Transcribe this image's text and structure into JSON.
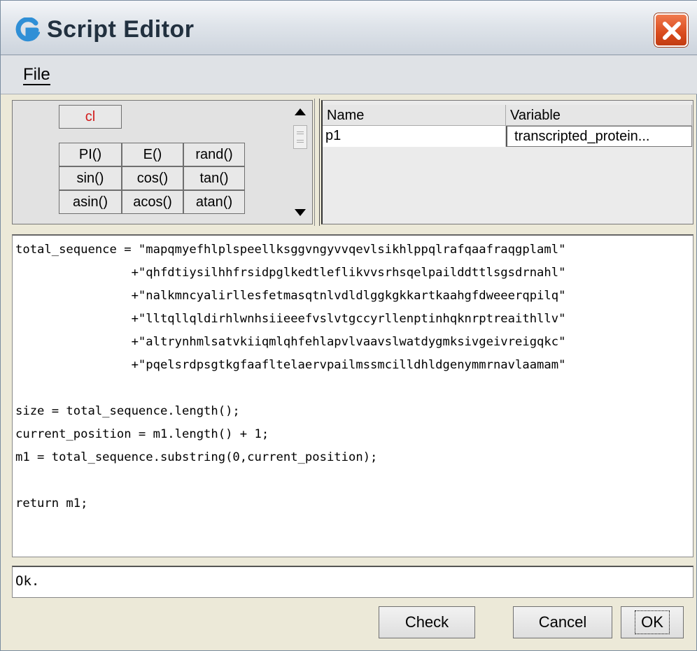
{
  "window": {
    "title": "Script Editor",
    "menu": {
      "file_label": "File"
    }
  },
  "buttons": {
    "clear": "cl",
    "pi": "PI()",
    "e": "E()",
    "rand": "rand()",
    "sin": "sin()",
    "cos": "cos()",
    "tan": "tan()",
    "asin": "asin()",
    "acos": "acos()",
    "atan": "atan()"
  },
  "variables_table": {
    "columns": [
      "Name",
      "Variable"
    ],
    "rows": [
      {
        "name": "p1",
        "variable": "transcripted_protein..."
      }
    ]
  },
  "editor": {
    "lines": [
      "total_sequence = \"mapqmyefhlplspeellksggvngyvvqevlsikhlppqlrafqaafraqgplaml\"",
      "                +\"qhfdtiysilhhfrsidpglkedtleflikvvsrhsqelpailddttlsgsdrnahl\"",
      "                +\"nalkmncyalirllesfetmasqtnlvdldlggkgkkartkaahgfdweeerqpilq\"",
      "                +\"lltqllqldirhlwnhsiieeefvslvtgccyrllenptinhqknrptreaithllv\"",
      "                +\"altrynhmlsatvkiiqmlqhfehlapvlvaavslwatdygmksivgeivreigqkc\"",
      "                +\"pqelsrdpsgtkgfaafltelaervpailmssmcilldhldgenymmrnavlaamam\"",
      "",
      "size = total_sequence.length();",
      "current_position = m1.length() + 1;",
      "m1 = total_sequence.substring(0,current_position);",
      "",
      "return m1;"
    ]
  },
  "status": {
    "text": "Ok."
  },
  "dialog_buttons": {
    "check": "Check",
    "cancel": "Cancel",
    "ok": "OK"
  },
  "colors": {
    "clear_button_text": "#d21c1c",
    "close_button": "#d94b1d"
  },
  "icons": {
    "app": "app-logo-icon",
    "close": "close-icon",
    "scroll_up": "arrow-up-icon",
    "scroll_down": "arrow-down-icon"
  }
}
